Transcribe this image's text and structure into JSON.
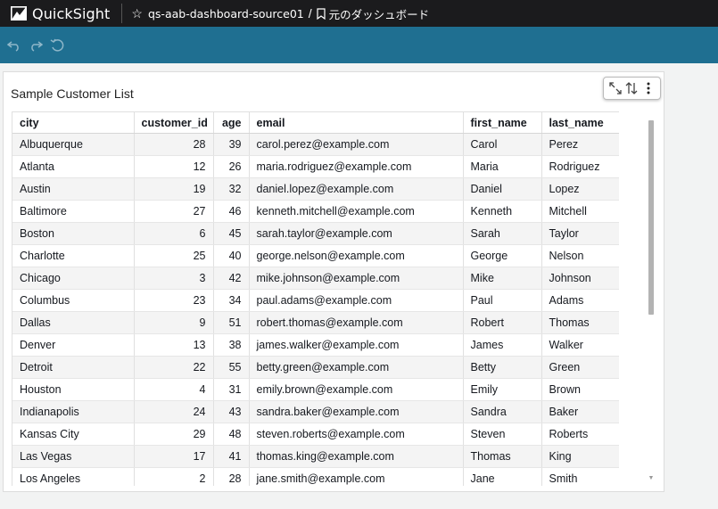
{
  "topbar": {
    "brand": "QuickSight",
    "analysis_name": "qs-aab-dashboard-source01",
    "separator": "/",
    "dashboard_name": "元のダッシュボード",
    "bg_color": "#1b1b1d"
  },
  "toolbar": {
    "bg_color": "#1f6f91",
    "buttons": [
      "undo-icon",
      "redo-icon",
      "reset-icon"
    ]
  },
  "visual": {
    "title": "Sample Customer List",
    "menu_icons": [
      "expand-icon",
      "sort-icon",
      "more-options-icon"
    ],
    "columns": [
      "city",
      "customer_id",
      "age",
      "email",
      "first_name",
      "last_name"
    ],
    "rows": [
      [
        "Albuquerque",
        "28",
        "39",
        "carol.perez@example.com",
        "Carol",
        "Perez"
      ],
      [
        "Atlanta",
        "12",
        "26",
        "maria.rodriguez@example.com",
        "Maria",
        "Rodriguez"
      ],
      [
        "Austin",
        "19",
        "32",
        "daniel.lopez@example.com",
        "Daniel",
        "Lopez"
      ],
      [
        "Baltimore",
        "27",
        "46",
        "kenneth.mitchell@example.com",
        "Kenneth",
        "Mitchell"
      ],
      [
        "Boston",
        "6",
        "45",
        "sarah.taylor@example.com",
        "Sarah",
        "Taylor"
      ],
      [
        "Charlotte",
        "25",
        "40",
        "george.nelson@example.com",
        "George",
        "Nelson"
      ],
      [
        "Chicago",
        "3",
        "42",
        "mike.johnson@example.com",
        "Mike",
        "Johnson"
      ],
      [
        "Columbus",
        "23",
        "34",
        "paul.adams@example.com",
        "Paul",
        "Adams"
      ],
      [
        "Dallas",
        "9",
        "51",
        "robert.thomas@example.com",
        "Robert",
        "Thomas"
      ],
      [
        "Denver",
        "13",
        "38",
        "james.walker@example.com",
        "James",
        "Walker"
      ],
      [
        "Detroit",
        "22",
        "55",
        "betty.green@example.com",
        "Betty",
        "Green"
      ],
      [
        "Houston",
        "4",
        "31",
        "emily.brown@example.com",
        "Emily",
        "Brown"
      ],
      [
        "Indianapolis",
        "24",
        "43",
        "sandra.baker@example.com",
        "Sandra",
        "Baker"
      ],
      [
        "Kansas City",
        "29",
        "48",
        "steven.roberts@example.com",
        "Steven",
        "Roberts"
      ],
      [
        "Las Vegas",
        "17",
        "41",
        "thomas.king@example.com",
        "Thomas",
        "King"
      ],
      [
        "Los Angeles",
        "2",
        "28",
        "jane.smith@example.com",
        "Jane",
        "Smith"
      ]
    ]
  }
}
